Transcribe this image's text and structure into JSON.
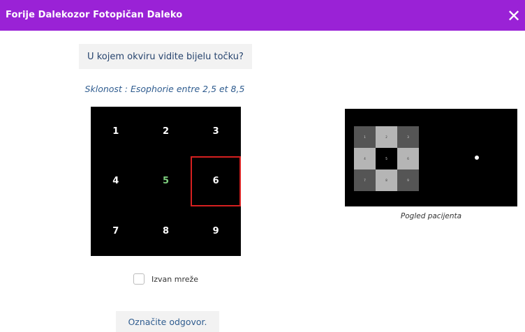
{
  "window": {
    "title": "Forije Dalekozor Fotopičan Daleko",
    "close_symbol": "✕"
  },
  "question": "U kojem okviru vidite bijelu točku?",
  "tendency": "Sklonost : Esophorie entre 2,5 et 8,5",
  "grid": {
    "cells": [
      "1",
      "2",
      "3",
      "4",
      "5",
      "6",
      "7",
      "8",
      "9"
    ],
    "selected": "6",
    "highlighted": "5"
  },
  "outside_grid": {
    "label": "Izvan mreže",
    "checked": false
  },
  "submit_label": "Označite odgovor.",
  "patient_view": {
    "caption": "Pogled pacijenta",
    "mini_cells": [
      "1",
      "2",
      "3",
      "4",
      "5",
      "6",
      "7",
      "8",
      "9"
    ]
  },
  "colors": {
    "titlebar": "#9a22d6",
    "selection": "#d62020",
    "highlight": "#7fd07f"
  },
  "icons": {
    "close": "close-icon"
  }
}
